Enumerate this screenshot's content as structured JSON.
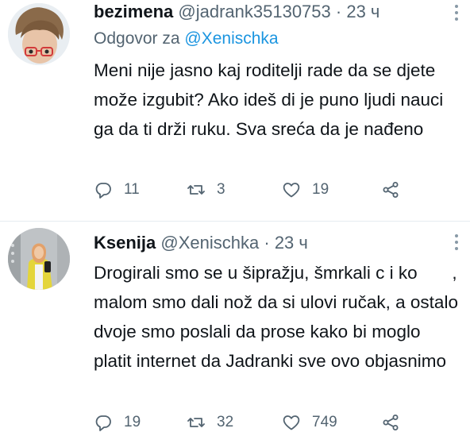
{
  "colors": {
    "link": "#1b95e0",
    "text": "#0f1419",
    "secondary": "#536471",
    "divider": "#e6ecf0"
  },
  "tweets": [
    {
      "name": "bezimena",
      "handle": "@jadrank35130753",
      "separator": "·",
      "time": "23 ч",
      "replying_prefix": "Odgovor za",
      "replying_to": "@Xenischka",
      "text": "Meni nije jasno kaj roditelji rade da se djete može izgubit? Ako ideš di je puno ljudi nauci ga da ti drži ruku. Sva sreća da je nađeno",
      "replies": "11",
      "retweets": "3",
      "likes": "19",
      "icons": [
        "reply-icon",
        "retweet-icon",
        "heart-icon",
        "share-icon",
        "more-icon"
      ]
    },
    {
      "name": "Ksenija",
      "handle": "@Xenischka",
      "separator": "·",
      "time": "23 ч",
      "text": "Drogirali smo se u šipražju, šmrkali c i ko       , malom smo dali nož da si ulovi ručak, a ostalo dvoje smo poslali da prose kako bi moglo platit internet da Jadranki sve ovo objasnimo",
      "replies": "19",
      "retweets": "32",
      "likes": "749",
      "icons": [
        "reply-icon",
        "retweet-icon",
        "heart-icon",
        "share-icon",
        "more-icon"
      ]
    }
  ]
}
